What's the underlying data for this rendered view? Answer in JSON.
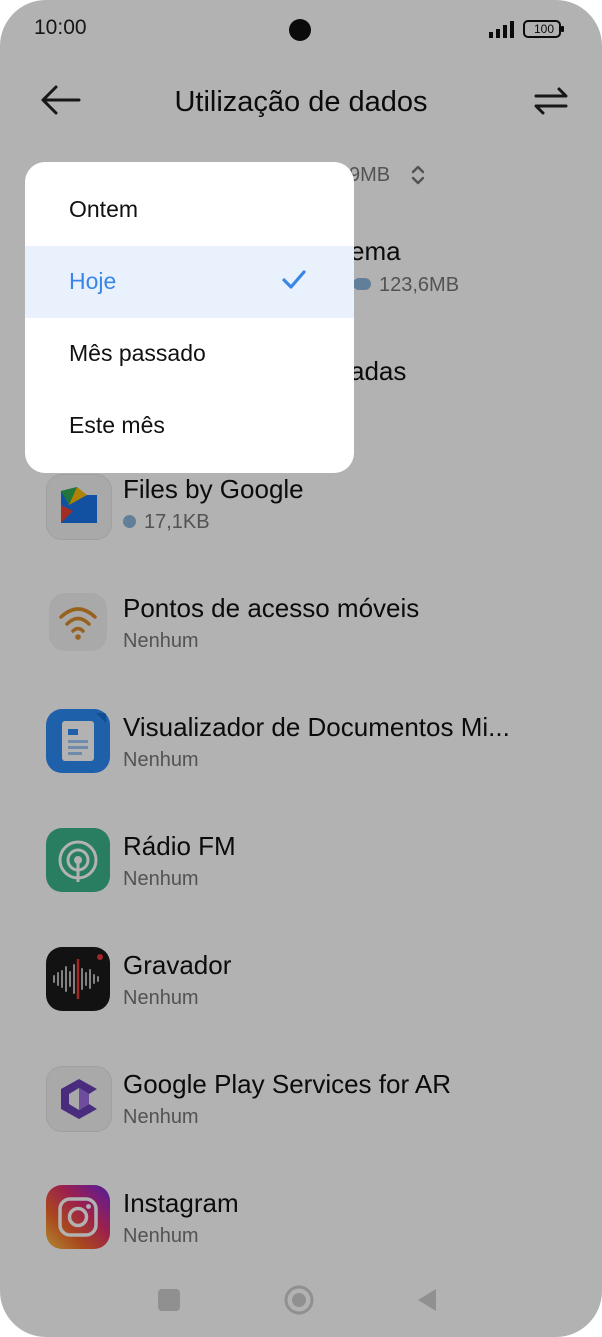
{
  "status_bar": {
    "time": "10:00",
    "battery": "100"
  },
  "header": {
    "title": "Utilização de dados"
  },
  "range_value": "9MB",
  "list": [
    {
      "name": "ema",
      "usage": "123,6MB",
      "indicator": "bar"
    },
    {
      "name": "adas",
      "usage": "",
      "indicator": "none"
    },
    {
      "name": "Files by Google",
      "usage": "17,1KB",
      "indicator": "dot"
    },
    {
      "name": "Pontos de acesso móveis",
      "usage": "Nenhum",
      "indicator": "none"
    },
    {
      "name": "Visualizador de Documentos Mi...",
      "usage": "Nenhum",
      "indicator": "none"
    },
    {
      "name": "Rádio FM",
      "usage": "Nenhum",
      "indicator": "none"
    },
    {
      "name": "Gravador",
      "usage": "Nenhum",
      "indicator": "none"
    },
    {
      "name": "Google Play Services for AR",
      "usage": "Nenhum",
      "indicator": "none"
    },
    {
      "name": "Instagram",
      "usage": "Nenhum",
      "indicator": "none"
    }
  ],
  "menu": {
    "items": [
      {
        "label": "Ontem",
        "selected": false
      },
      {
        "label": "Hoje",
        "selected": true
      },
      {
        "label": "Mês passado",
        "selected": false
      },
      {
        "label": "Este mês",
        "selected": false
      }
    ]
  },
  "colors": {
    "accent": "#3a86e8",
    "selected_bg": "#e9f1fd",
    "indicator": "#8db7dd"
  }
}
